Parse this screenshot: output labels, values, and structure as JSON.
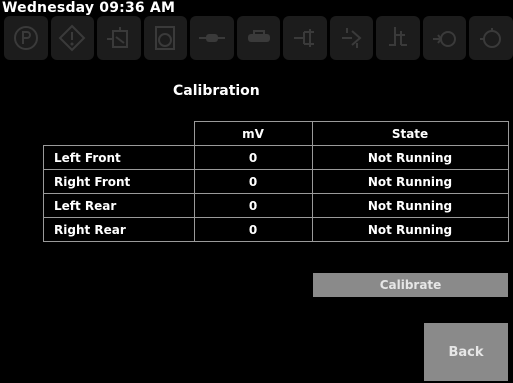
{
  "status": {
    "datetime": "Wednesday 09:36 AM"
  },
  "icons": [
    "parking-brake-icon",
    "warning-diamond-icon",
    "tilt-icon",
    "engine-oil-icon",
    "hydraulic-icon",
    "pump-icon",
    "lift-icon",
    "gear-icon",
    "jack-icon",
    "motor-icon",
    "valve-icon"
  ],
  "title": "Calibration",
  "table": {
    "headers": [
      "mV",
      "State"
    ],
    "rows": [
      {
        "label": "Left Front",
        "mv": "0",
        "state": "Not Running"
      },
      {
        "label": "Right Front",
        "mv": "0",
        "state": "Not Running"
      },
      {
        "label": "Left Rear",
        "mv": "0",
        "state": "Not Running"
      },
      {
        "label": "Right Rear",
        "mv": "0",
        "state": "Not Running"
      }
    ]
  },
  "buttons": {
    "calibrate": "Calibrate",
    "back": "Back"
  }
}
